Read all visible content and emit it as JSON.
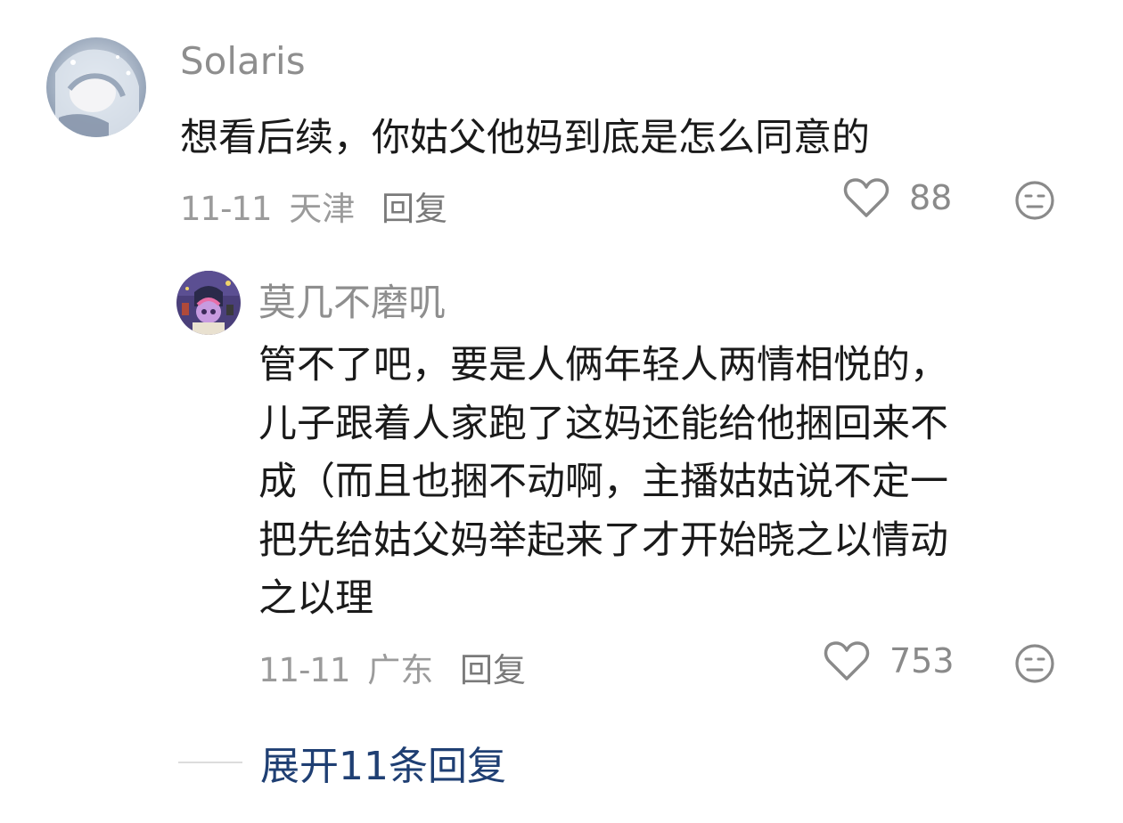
{
  "comments": [
    {
      "username": "Solaris",
      "avatar_icon": "anime-character-avatar",
      "lines": [
        "想看后续，你姑父他妈到底是怎么同意的"
      ],
      "date": "11-11",
      "location": "天津",
      "reply_label": "回复",
      "likes": "88",
      "like_icon": "heart-outline-icon",
      "react_icon": "neutral-face-icon"
    },
    {
      "username": "莫几不磨叽",
      "avatar_icon": "pony-character-avatar",
      "lines": [
        "管不了吧，要是人俩年轻人两情相悦的，",
        "儿子跟着人家跑了这妈还能给他捆回来不",
        "成（而且也捆不动啊，主播姑姑说不定一",
        "把先给姑父妈举起来了才开始晓之以情动",
        "之以理"
      ],
      "date": "11-11",
      "location": "广东",
      "reply_label": "回复",
      "likes": "753",
      "like_icon": "heart-outline-icon",
      "react_icon": "neutral-face-icon"
    }
  ],
  "expand_replies": {
    "label": "展开11条回复"
  },
  "colors": {
    "username": "#8e8e8e",
    "content": "#1a1a1a",
    "meta": "#9b9b9b",
    "expand_link": "#1f3f73",
    "icon_stroke": "#8a8a8a"
  }
}
